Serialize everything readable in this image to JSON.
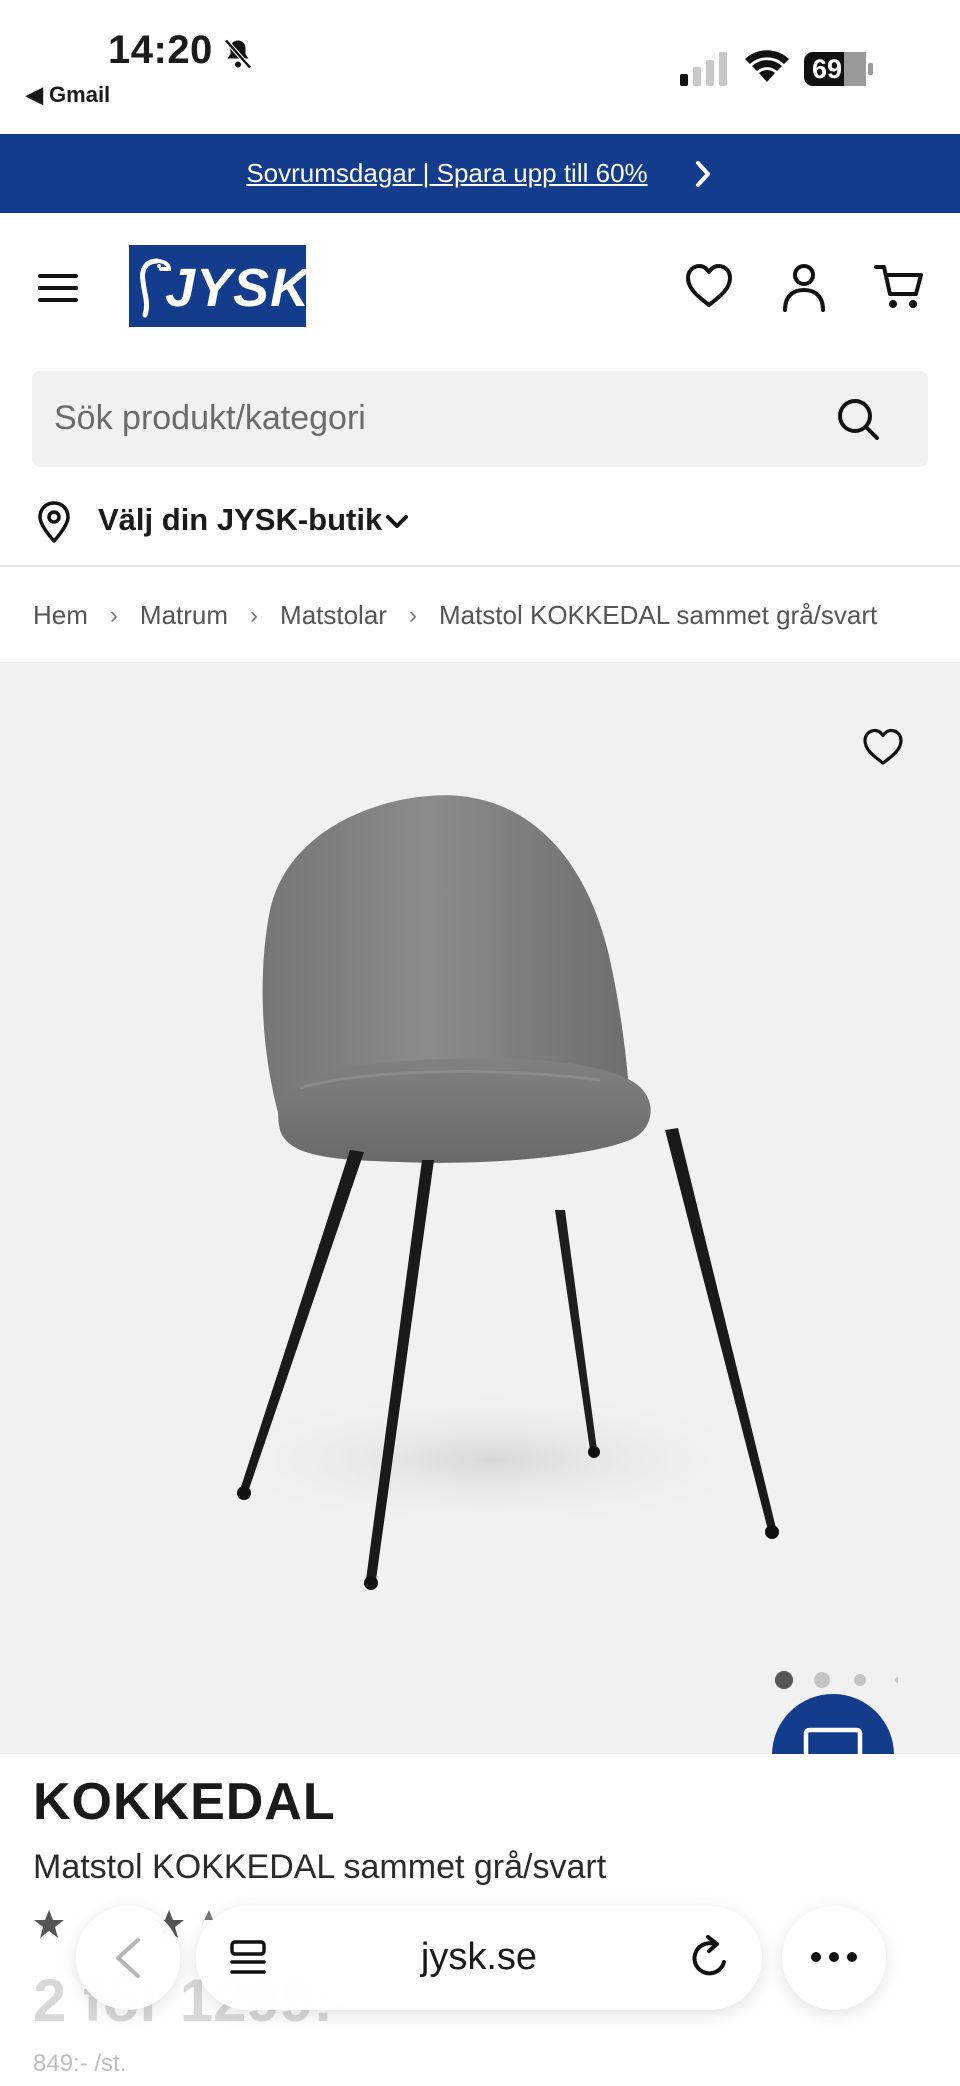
{
  "status_bar": {
    "time": "14:20",
    "back_app": "◀ Gmail",
    "battery": "69"
  },
  "promo": {
    "text": "Sovrumsdagar | Spara upp till 60%"
  },
  "header": {
    "logo_text": "JYSK"
  },
  "search": {
    "placeholder": "Sök produkt/kategori"
  },
  "store": {
    "label": "Välj din JYSK-butik"
  },
  "breadcrumb": [
    "Hem",
    "Matrum",
    "Matstolar",
    "Matstol KOKKEDAL sammet grå/svart"
  ],
  "gallery": {
    "image_count": 4,
    "active_index": 0
  },
  "product": {
    "brand": "KOKKEDAL",
    "title": "Matstol KOKKEDAL sammet grå/svart",
    "price": "2 för 1299:-",
    "unit_price": "849:- /st."
  },
  "browser": {
    "url": "jysk.se"
  },
  "colors": {
    "brand_blue": "#143c8c",
    "gallery_bg": "#f1f1f1",
    "search_bg": "#f1f1f1"
  }
}
